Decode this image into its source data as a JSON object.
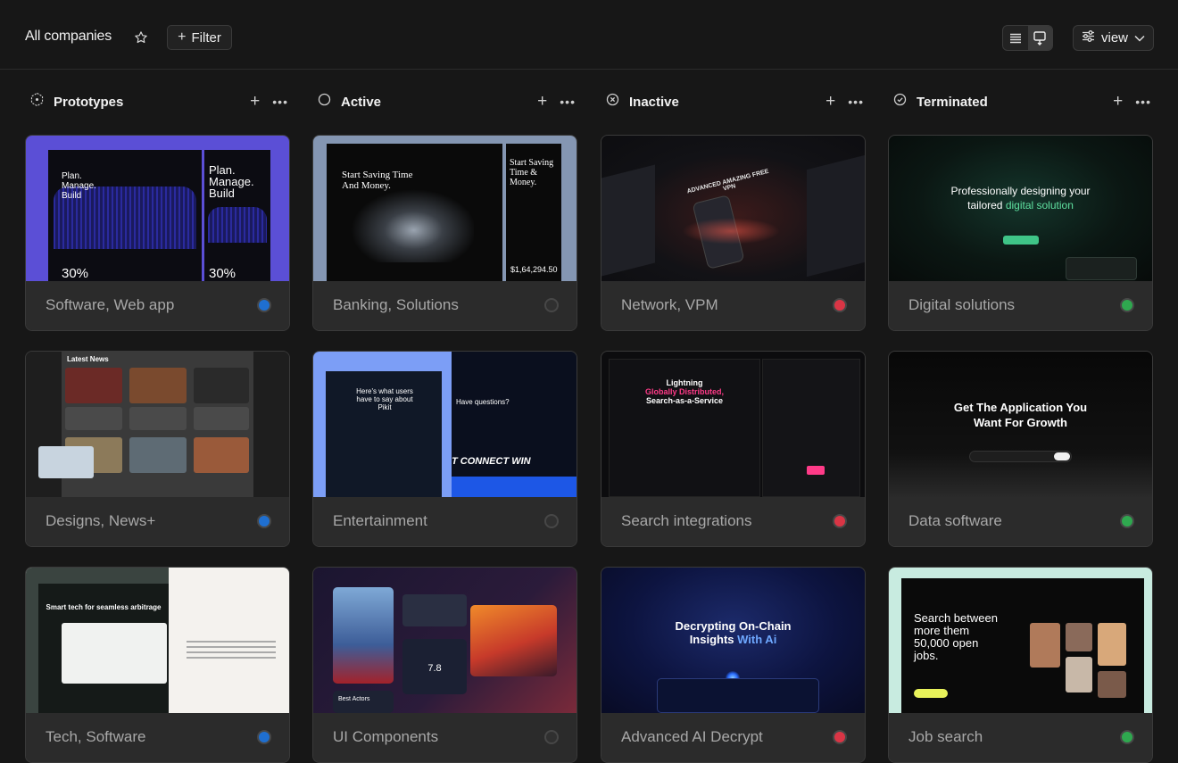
{
  "header": {
    "title": "All companies",
    "filter_label": "Filter",
    "view_label": "view"
  },
  "columns": [
    {
      "label": "Prototypes",
      "icon": "prototype-icon"
    },
    {
      "label": "Active",
      "icon": "circle-icon"
    },
    {
      "label": "Inactive",
      "icon": "circle-x-icon"
    },
    {
      "label": "Terminated",
      "icon": "circle-check-icon"
    }
  ],
  "status_colors": {
    "blue": "#1f6fd0",
    "gray": "#303030",
    "red": "#d93545",
    "green": "#2fa84f"
  },
  "cards": [
    {
      "name": "Software, Web app",
      "status": "blue",
      "thumb": {
        "l1": "Plan.",
        "l2": "Manage.",
        "l3": "Build",
        "stat": "30%"
      }
    },
    {
      "name": "Banking, Solutions",
      "status": "gray",
      "thumb": {
        "headline": "Start Saving Time And Money.",
        "side": "Start Saving Time & Money.",
        "amount": "$1,64,294.50"
      }
    },
    {
      "name": "Network, VPM",
      "status": "red",
      "thumb": {
        "caption": "ADVANCED AMAZING FREE VPN"
      }
    },
    {
      "name": "Digital solutions",
      "status": "green",
      "thumb": {
        "l1": "Professionally designing your",
        "l2a": "tailored ",
        "l2b": "digital solution"
      }
    },
    {
      "name": "Designs, News+",
      "status": "blue",
      "thumb": {
        "heading": "Latest News"
      }
    },
    {
      "name": "Entertainment",
      "status": "gray",
      "thumb": {
        "text": "Here's what users have to say about Pikit",
        "q": "Have questions?",
        "band": "T CONNECT WIN"
      }
    },
    {
      "name": "Search integrations",
      "status": "red",
      "thumb": {
        "l1": "Lightning",
        "l2": "Globally Distributed,",
        "l3": "Search-as-a-Service"
      }
    },
    {
      "name": "Data software",
      "status": "green",
      "thumb": {
        "l1": "Get The Application You",
        "l2": "Want For Growth"
      }
    },
    {
      "name": "Tech, Software",
      "status": "blue",
      "thumb": {
        "text": "Smart tech for seamless arbitrage"
      }
    },
    {
      "name": "UI Components",
      "status": "gray",
      "thumb": {
        "rating": "7.8",
        "section": "Best Actors"
      }
    },
    {
      "name": "Advanced AI Decrypt",
      "status": "red",
      "thumb": {
        "l1": "Decrypting On-Chain",
        "l2a": "Insights ",
        "l2b": "With Ai"
      }
    },
    {
      "name": "Job search",
      "status": "green",
      "thumb": {
        "l1": "Search between",
        "l2": "more them",
        "l3": "50,000 open",
        "l4": "jobs."
      }
    }
  ]
}
